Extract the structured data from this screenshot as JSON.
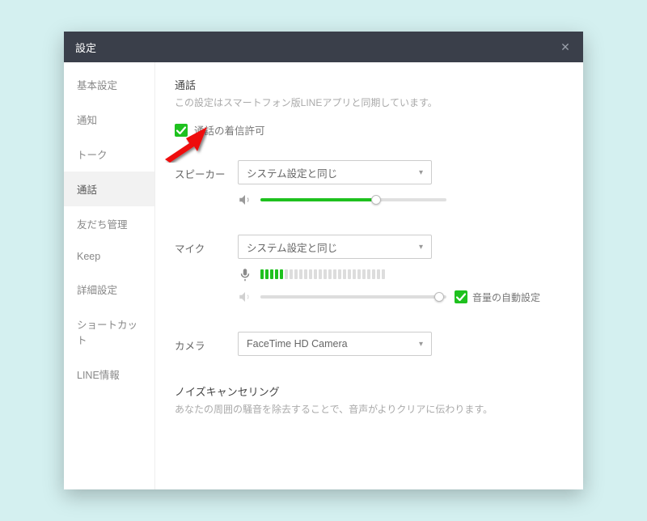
{
  "modal": {
    "title": "設定",
    "close_label": "✕"
  },
  "sidebar": {
    "items": [
      {
        "label": "基本設定"
      },
      {
        "label": "通知"
      },
      {
        "label": "トーク"
      },
      {
        "label": "通話",
        "active": true
      },
      {
        "label": "友だち管理"
      },
      {
        "label": "Keep"
      },
      {
        "label": "詳細設定"
      },
      {
        "label": "ショートカット"
      },
      {
        "label": "LINE情報"
      }
    ]
  },
  "content": {
    "section_title": "通話",
    "section_desc": "この設定はスマートフォン版LINEアプリと同期しています。",
    "allow_incoming": {
      "checked": true,
      "label": "通話の着信許可"
    },
    "speaker": {
      "label": "スピーカー",
      "selected": "システム設定と同じ",
      "volume_percent": 62
    },
    "mic": {
      "label": "マイク",
      "selected": "システム設定と同じ",
      "level_active_bars": 5,
      "level_total_bars": 26,
      "volume_percent": 96,
      "auto_gain": {
        "checked": true,
        "label": "音量の自動設定"
      }
    },
    "camera": {
      "label": "カメラ",
      "selected": "FaceTime HD Camera"
    },
    "noise": {
      "title": "ノイズキャンセリング",
      "desc": "あなたの周囲の騒音を除去することで、音声がよりクリアに伝わります。"
    }
  },
  "colors": {
    "accent": "#1ec11e",
    "titlebar": "#3a3f4a"
  }
}
